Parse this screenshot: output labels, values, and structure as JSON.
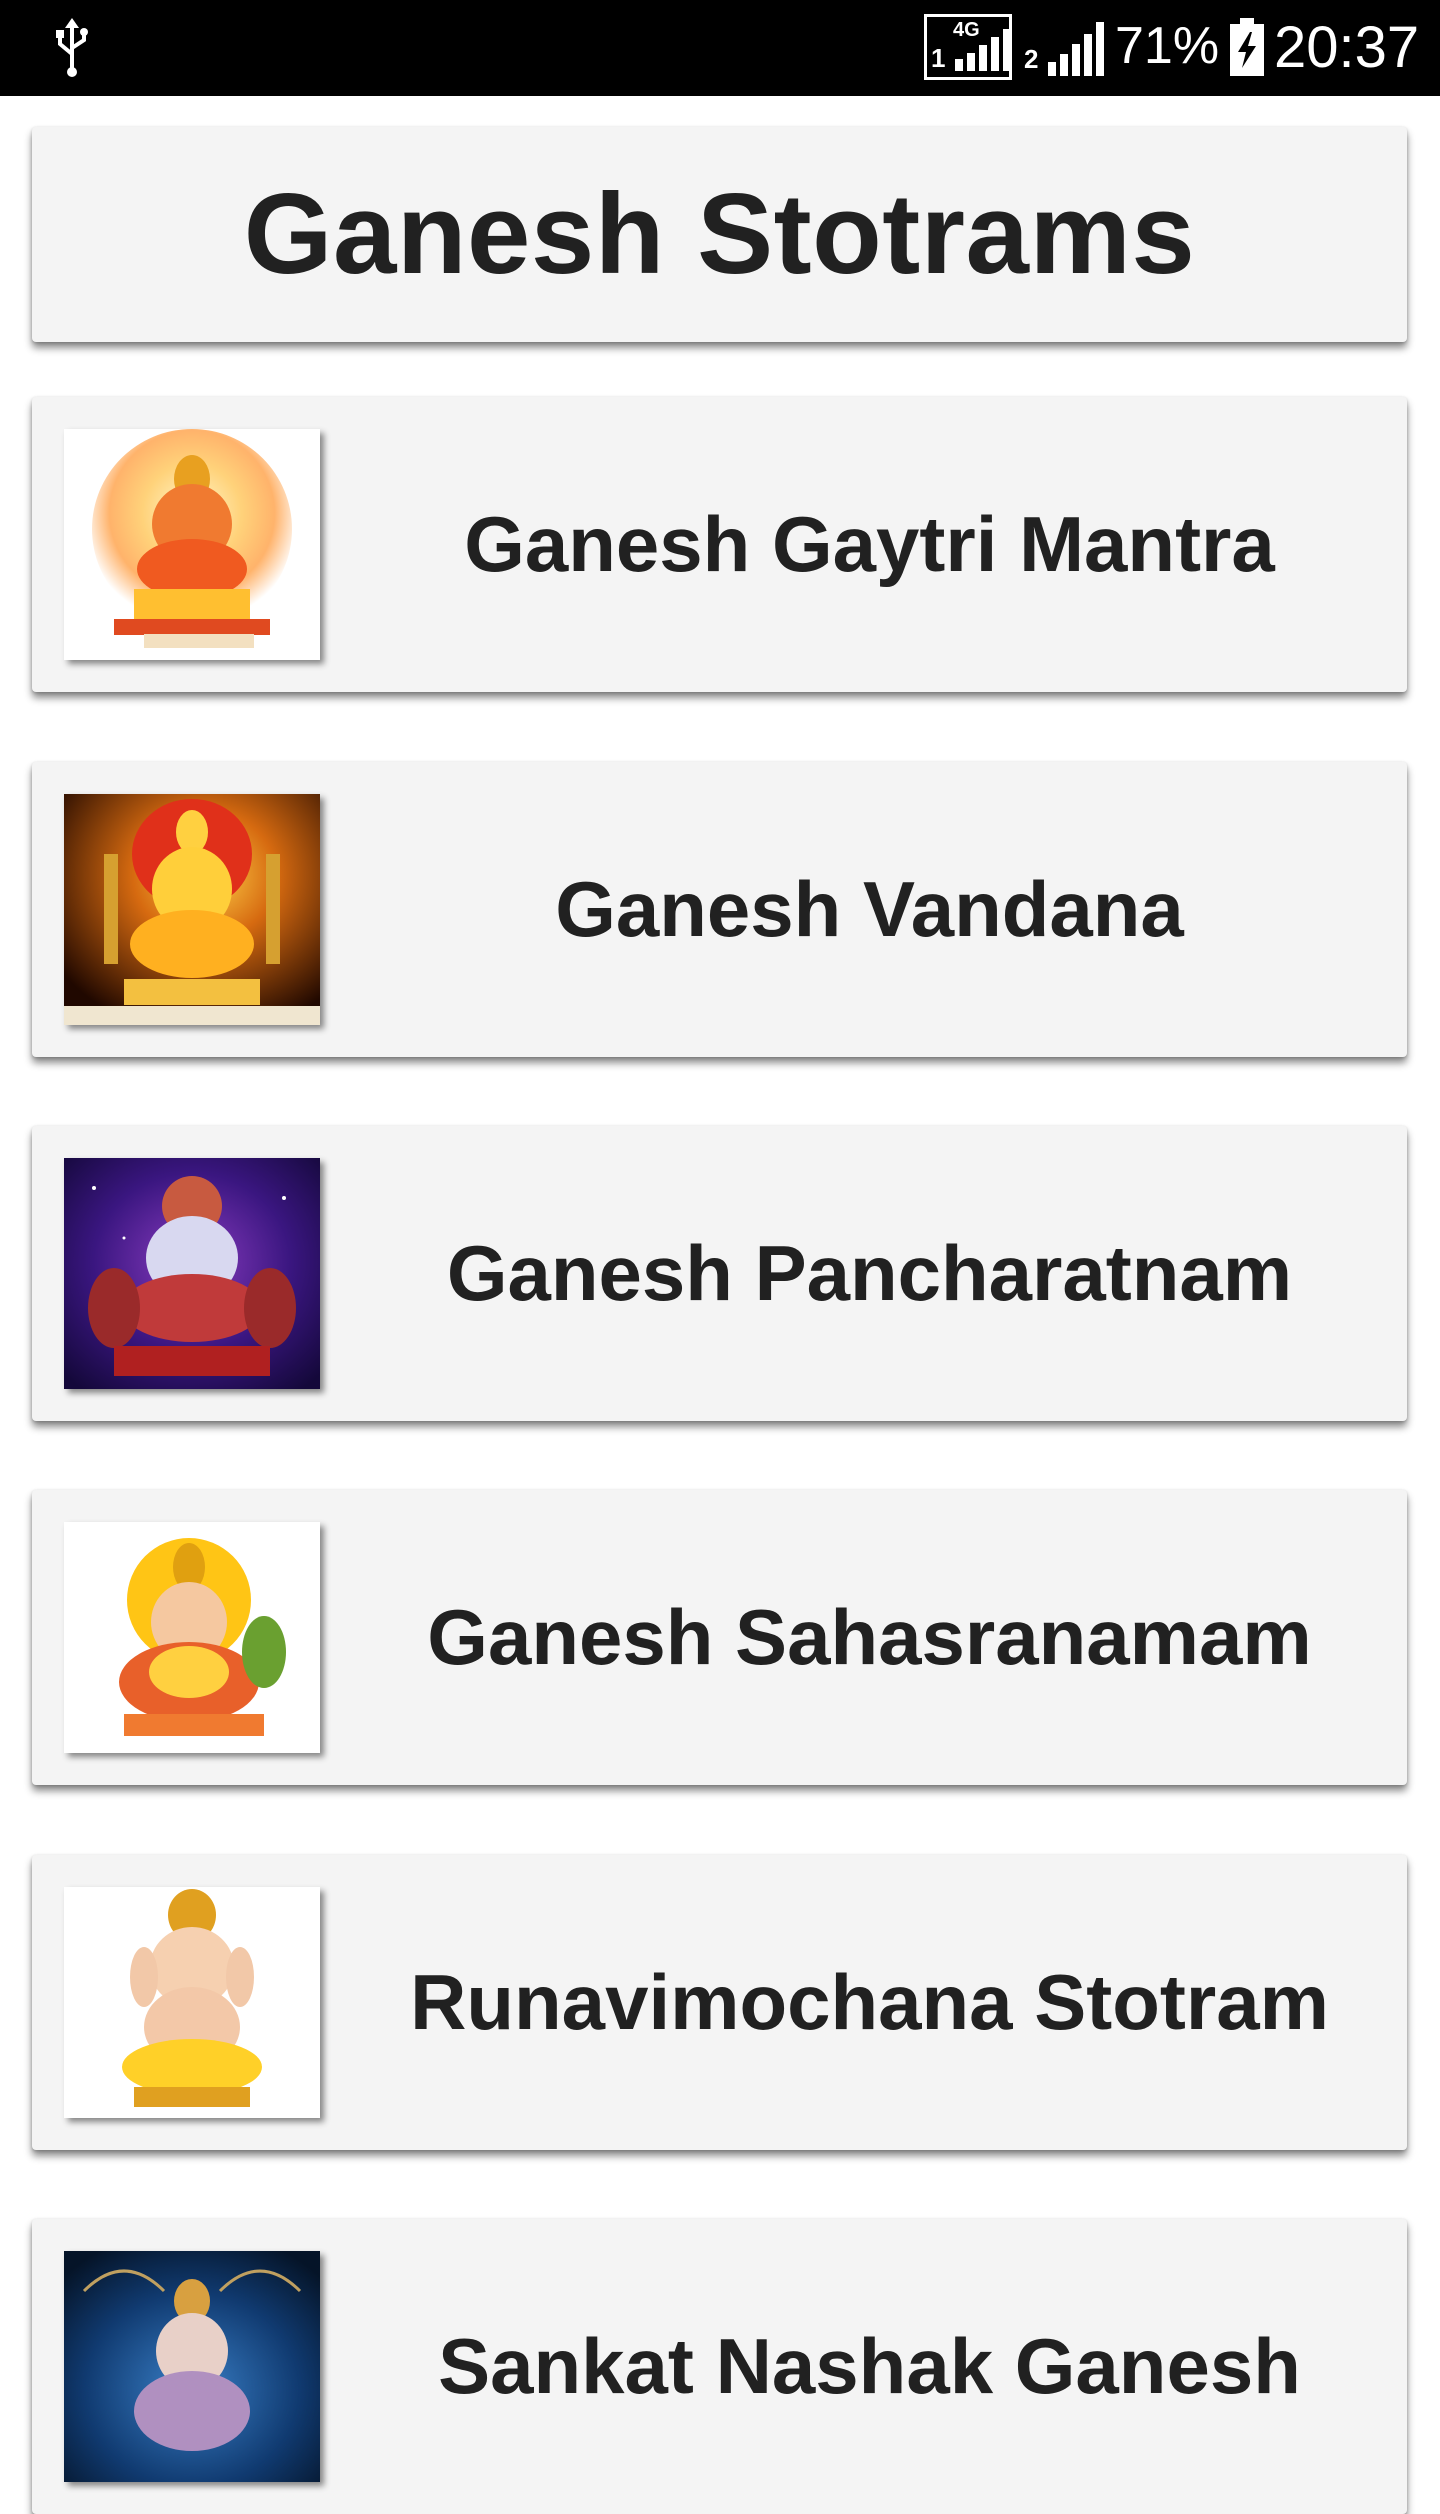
{
  "status_bar": {
    "network_type": "4G",
    "sim1_label": "1",
    "sim2_label": "2",
    "battery_percent": "71%",
    "time": "20:37",
    "icons": [
      "usb-icon",
      "signal-sim1-icon",
      "signal-sim2-icon",
      "battery-charging-icon"
    ]
  },
  "header": {
    "title": "Ganesh Stotrams"
  },
  "list": {
    "items": [
      {
        "label": "Ganesh Gaytri Mantra",
        "thumbnail": "ganesh-image-halo"
      },
      {
        "label": "Ganesh Vandana",
        "thumbnail": "ganesh-image-golden"
      },
      {
        "label": "Ganesh Pancharatnam",
        "thumbnail": "ganesh-image-cosmic"
      },
      {
        "label": "Ganesh Sahasranamam",
        "thumbnail": "ganesh-image-sun"
      },
      {
        "label": "Runavimochana Stotram",
        "thumbnail": "ganesh-image-white"
      },
      {
        "label": "Sankat Nashak Ganesh",
        "thumbnail": "ganesh-image-blue"
      }
    ]
  },
  "colors": {
    "status_bar_bg": "#000000",
    "card_bg": "#f4f4f4",
    "text": "#212121",
    "page_bg": "#ffffff"
  }
}
